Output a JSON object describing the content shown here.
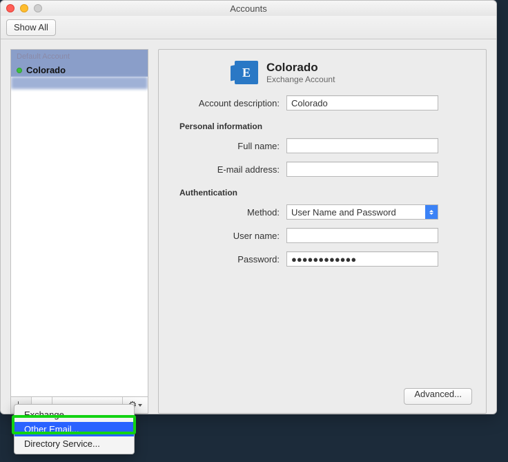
{
  "window": {
    "title": "Accounts"
  },
  "toolbar": {
    "show_all": "Show All"
  },
  "sidebar": {
    "group_header": "Default Account",
    "accounts": [
      {
        "name": "Colorado"
      }
    ],
    "footer": {
      "add_glyph": "＋",
      "remove_glyph": "−",
      "gear_glyph": "⚙"
    }
  },
  "popup": {
    "items": [
      {
        "label": "Exchange...",
        "selected": false
      },
      {
        "label": "Other Email...",
        "selected": true
      },
      {
        "label": "Directory Service...",
        "selected": false
      }
    ]
  },
  "detail": {
    "title": "Colorado",
    "subtitle": "Exchange Account",
    "labels": {
      "account_description": "Account description:",
      "personal_info": "Personal information",
      "full_name": "Full name:",
      "email": "E-mail address:",
      "authentication": "Authentication",
      "method": "Method:",
      "user_name": "User name:",
      "password": "Password:"
    },
    "values": {
      "account_description": "Colorado",
      "full_name": "",
      "email": "",
      "method": "User Name and Password",
      "user_name": "",
      "password": "●●●●●●●●●●●●"
    },
    "buttons": {
      "advanced": "Advanced..."
    }
  },
  "icons": {
    "exchange_letter": "E"
  }
}
